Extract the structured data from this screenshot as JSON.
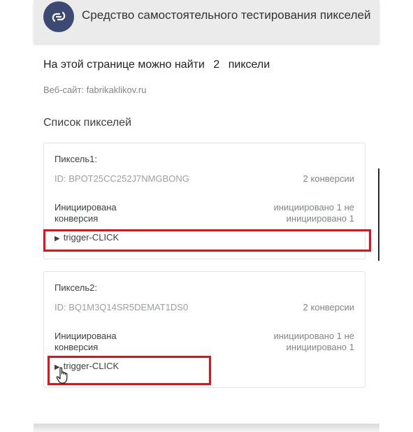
{
  "header": {
    "title": "Средство самостоятельного тестирования пикселей",
    "logo_icon": "link-icon",
    "logo_color": "#3c4a73"
  },
  "summary": {
    "prefix": "На этой странице можно найти",
    "count": "2",
    "suffix": "пиксели"
  },
  "website": "Веб-сайт: fabrikaklikov.ru",
  "list_title": "Список пикселей",
  "pixels": [
    {
      "name": "Пиксель1:",
      "id": "ID: BPOT25CC252J7NMGBONG",
      "conversions": "2 конверсии",
      "event_label_line1": "Инициирована",
      "event_label_line2": "конверсия",
      "event_status_line1": "инициировано 1 не",
      "event_status_line2": "инициировано 1",
      "trigger": "trigger-CLICK"
    },
    {
      "name": "Пиксель2:",
      "id": "ID: BQ1M3Q14SR5DEMAT1DS0",
      "conversions": "2 конверсии",
      "event_label_line1": "Инициирована",
      "event_label_line2": "конверсия",
      "event_status_line1": "инициировано 1 не",
      "event_status_line2": "инициировано 1",
      "trigger": "trigger-CLICK"
    }
  ],
  "highlight_color": "#e0121b"
}
